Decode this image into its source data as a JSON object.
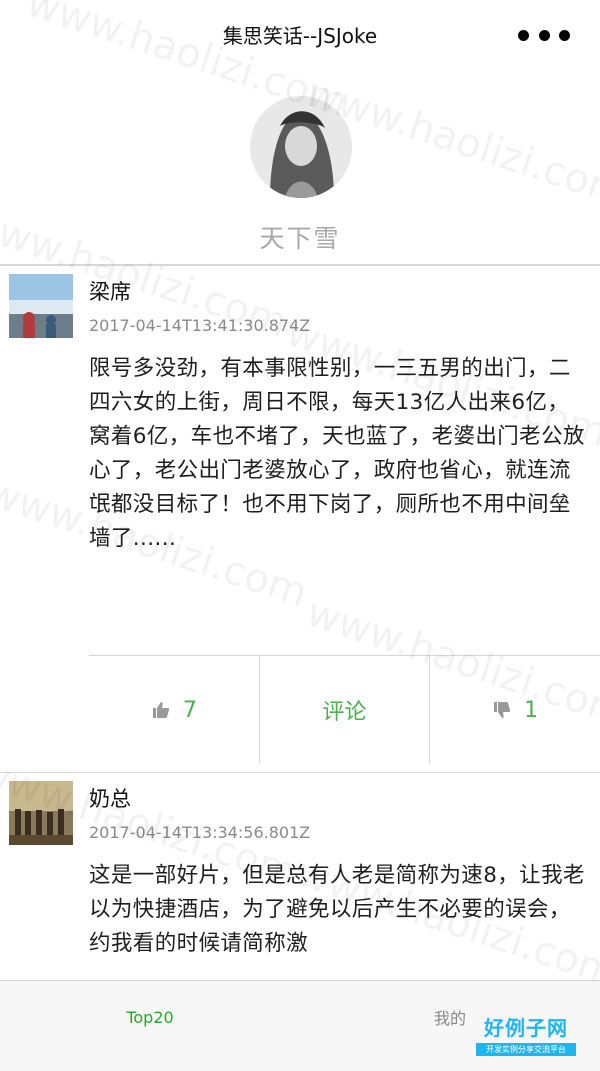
{
  "header": {
    "title": "集思笑话--JSJoke",
    "more_icon": "more-dots-icon"
  },
  "profile": {
    "name": "天下雪"
  },
  "posts": [
    {
      "author": "梁席",
      "time": "2017-04-14T13:41:30.874Z",
      "content": "限号多没劲，有本事限性别，一三五男的出门，二四六女的上街，周日不限，每天13亿人出来6亿，窝着6亿，车也不堵了，天也蓝了，老婆出门老公放心了，老公出门老婆放心了，政府也省心，就连流氓都没目标了！也不用下岗了，厕所也不用中间垒墙了......",
      "likes": "7",
      "comment_label": "评论",
      "dislikes": "1"
    },
    {
      "author": "奶总",
      "time": "2017-04-14T13:34:56.801Z",
      "content": "这是一部好片，但是总有人老是简称为速8，让我老以为快捷酒店，为了避免以后产生不必要的误会，约我看的时候请简称激"
    }
  ],
  "tabbar": {
    "tab1": "Top20",
    "tab2": "我的"
  },
  "watermark": {
    "text": "www.haolizi.com",
    "logo_main": "好例子网",
    "logo_sub": "开发实例分享交流平台"
  },
  "colors": {
    "accent": "#4caf50",
    "tab_active": "#2aa52a",
    "logo": "#1fb6f0"
  }
}
